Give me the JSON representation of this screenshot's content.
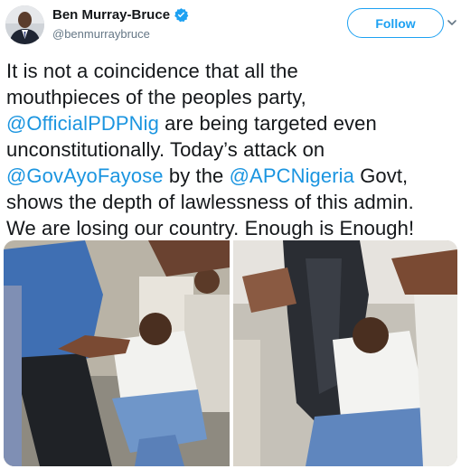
{
  "user": {
    "display_name": "Ben Murray-Bruce",
    "handle": "@benmurraybruce",
    "verified": true
  },
  "actions": {
    "follow_label": "Follow"
  },
  "tweet": {
    "lines": [
      [
        "It is not a coincidence that all the"
      ],
      [
        "mouthpieces of the peoples party,"
      ],
      [
        "@OfficialPDPNig",
        " are being targeted even"
      ],
      [
        "unconstitutionally. Today’s attack on"
      ],
      [
        "@GovAyoFayose",
        " by the ",
        "@APCNigeria",
        " Govt,"
      ],
      [
        "shows the depth of lawlessness of this admin."
      ],
      [
        "We are losing our country. Enough is Enough!"
      ]
    ]
  },
  "icons": {
    "verified": "verified-badge-icon",
    "menu": "chevron-down-icon"
  },
  "colors": {
    "accent": "#1da1f2",
    "mention": "#1b95e0",
    "text": "#14171a",
    "secondary": "#657786"
  }
}
